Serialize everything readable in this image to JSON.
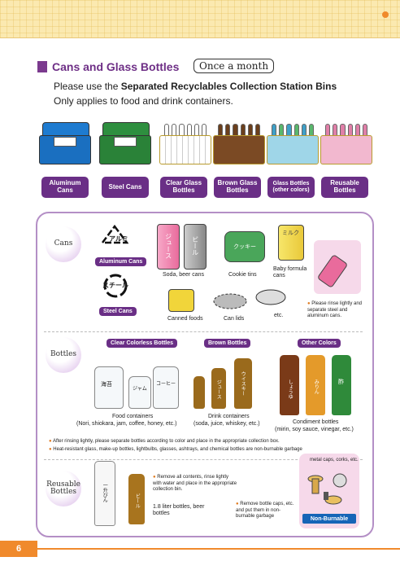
{
  "header": {
    "section_title": "Cans and Glass Bottles",
    "frequency_badge": "Once a month",
    "instruction_prefix": "Please use the ",
    "instruction_bold": "Separated Recyclables Collection Station Bins",
    "note": "Only applies to food and drink containers."
  },
  "bins": [
    {
      "label": "Aluminum Cans",
      "color": "#1e7bd0"
    },
    {
      "label": "Steel Cans",
      "color": "#2e8f3f"
    },
    {
      "label": "Clear Glass Bottles",
      "color": "#e8eef2"
    },
    {
      "label": "Brown Glass Bottles",
      "color": "#6b3f1d"
    },
    {
      "label": "Glass Bottles (other colors)",
      "color": "#3fa0c8"
    },
    {
      "label": "Reusable Bottles",
      "color": "#e07fa8"
    }
  ],
  "cans": {
    "category": "Cans",
    "aluminum_symbol": "アルミ",
    "aluminum_label": "Aluminum Cans",
    "steel_symbol": "スチール",
    "steel_label": "Steel Cans",
    "items": {
      "soda": "Soda, beer cans",
      "cookie": "Cookie tins",
      "baby": "Baby formula cans",
      "canned": "Canned foods",
      "lids": "Can lids",
      "etc": "etc."
    },
    "can_text": {
      "juice": "ジュース",
      "beer": "ビール",
      "cookie": "クッキー",
      "milk": "ミルク"
    },
    "tip": "Please rinse lightly and separate steel and aluminum cans."
  },
  "bottles": {
    "category": "Bottles",
    "clear_label": "Clear Colorless Bottles",
    "brown_label": "Brown Bottles",
    "other_label": "Other Colors",
    "food_caption": "Food containers",
    "food_detail": "(Nori, shiokara, jam, coffee, honey, etc.)",
    "drink_caption": "Drink containers",
    "drink_detail": "(soda, juice, whiskey, etc.)",
    "condiment_caption": "Condiment bottles",
    "condiment_detail": "(mirin, soy sauce, vinegar, etc.)",
    "jar_text": {
      "nori": "海苔",
      "jam": "ジャム",
      "coffee": "コーヒー",
      "juice": "ジュース",
      "whiskey": "ウイスキー",
      "soy": "しょうゆ",
      "mirin": "みりん",
      "vinegar": "酢"
    },
    "bullets": [
      "After rinsing lightly, please separate bottles according to color and place in the appropriate collection box.",
      "Heat-resistant glass, make-up bottles, lightbulbs, glasses, ashtrays, and chemical bottles are non-burnable garbage"
    ]
  },
  "reusable": {
    "category": "Reusable Bottles",
    "rinse_note": "Remove all contents, rinse lightly with water and place in the appropriate collection bin.",
    "liter_caption": "1.8 liter bottles, beer bottles",
    "bottle_text": {
      "sake": "一升びん",
      "beer": "ビール"
    },
    "caps_note": "Remove bottle caps, etc. and put them in non-burnable garbage",
    "metal_caps": "metal caps, corks, etc.",
    "non_burnable": "Non-Burnable"
  },
  "footer": {
    "page_number": "6"
  }
}
